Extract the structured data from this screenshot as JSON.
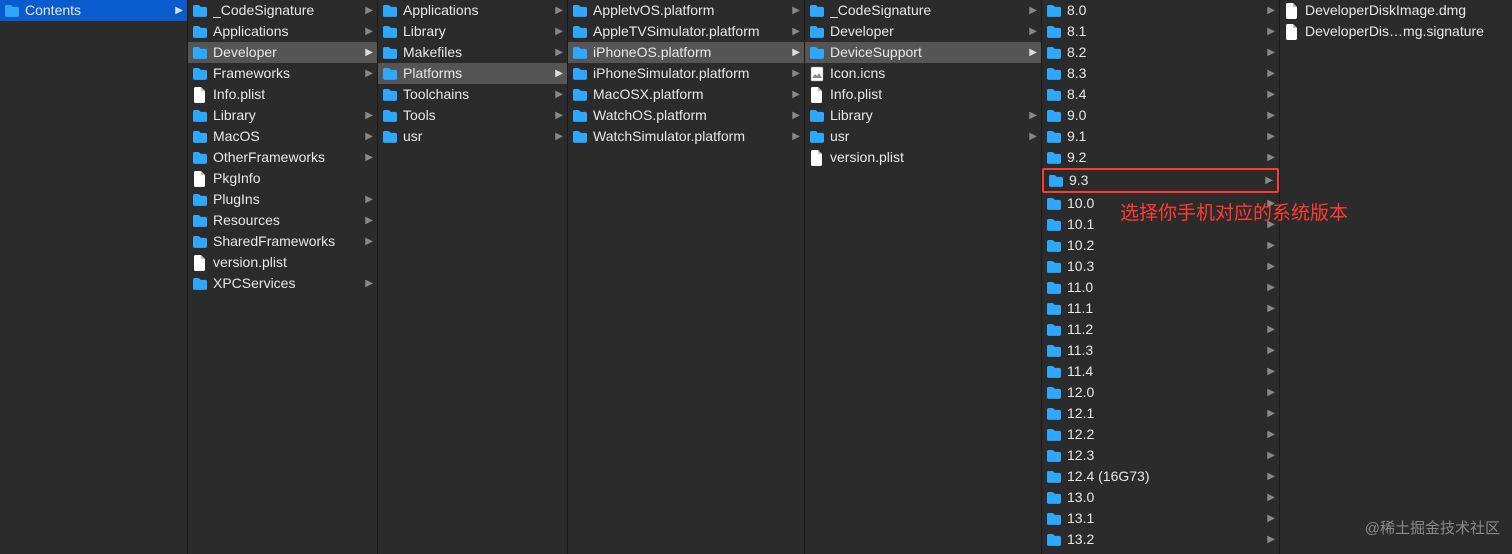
{
  "columns": [
    {
      "width_class": "col0",
      "items": [
        {
          "name": "Contents",
          "type": "folder",
          "hasChildren": true,
          "state": "selected"
        }
      ]
    },
    {
      "width_class": "col1",
      "items": [
        {
          "name": "_CodeSignature",
          "type": "folder",
          "hasChildren": true
        },
        {
          "name": "Applications",
          "type": "folder",
          "hasChildren": true
        },
        {
          "name": "Developer",
          "type": "folder",
          "hasChildren": true,
          "state": "pathed"
        },
        {
          "name": "Frameworks",
          "type": "folder",
          "hasChildren": true
        },
        {
          "name": "Info.plist",
          "type": "file"
        },
        {
          "name": "Library",
          "type": "folder",
          "hasChildren": true
        },
        {
          "name": "MacOS",
          "type": "folder",
          "hasChildren": true
        },
        {
          "name": "OtherFrameworks",
          "type": "folder",
          "hasChildren": true
        },
        {
          "name": "PkgInfo",
          "type": "file"
        },
        {
          "name": "PlugIns",
          "type": "folder",
          "hasChildren": true
        },
        {
          "name": "Resources",
          "type": "folder",
          "hasChildren": true
        },
        {
          "name": "SharedFrameworks",
          "type": "folder",
          "hasChildren": true
        },
        {
          "name": "version.plist",
          "type": "file"
        },
        {
          "name": "XPCServices",
          "type": "folder",
          "hasChildren": true
        }
      ]
    },
    {
      "width_class": "col2",
      "items": [
        {
          "name": "Applications",
          "type": "folder",
          "hasChildren": true
        },
        {
          "name": "Library",
          "type": "folder",
          "hasChildren": true
        },
        {
          "name": "Makefiles",
          "type": "folder",
          "hasChildren": true
        },
        {
          "name": "Platforms",
          "type": "folder",
          "hasChildren": true,
          "state": "pathed"
        },
        {
          "name": "Toolchains",
          "type": "folder",
          "hasChildren": true
        },
        {
          "name": "Tools",
          "type": "folder",
          "hasChildren": true
        },
        {
          "name": "usr",
          "type": "folder",
          "hasChildren": true
        }
      ]
    },
    {
      "width_class": "col3",
      "items": [
        {
          "name": "AppletvOS.platform",
          "type": "folder",
          "hasChildren": true
        },
        {
          "name": "AppleTVSimulator.platform",
          "type": "folder",
          "hasChildren": true
        },
        {
          "name": "iPhoneOS.platform",
          "type": "folder",
          "hasChildren": true,
          "state": "pathed"
        },
        {
          "name": "iPhoneSimulator.platform",
          "type": "folder",
          "hasChildren": true
        },
        {
          "name": "MacOSX.platform",
          "type": "folder",
          "hasChildren": true
        },
        {
          "name": "WatchOS.platform",
          "type": "folder",
          "hasChildren": true
        },
        {
          "name": "WatchSimulator.platform",
          "type": "folder",
          "hasChildren": true
        }
      ]
    },
    {
      "width_class": "col4",
      "items": [
        {
          "name": "_CodeSignature",
          "type": "folder",
          "hasChildren": true
        },
        {
          "name": "Developer",
          "type": "folder",
          "hasChildren": true
        },
        {
          "name": "DeviceSupport",
          "type": "folder",
          "hasChildren": true,
          "state": "pathed"
        },
        {
          "name": "Icon.icns",
          "type": "image"
        },
        {
          "name": "Info.plist",
          "type": "file"
        },
        {
          "name": "Library",
          "type": "folder",
          "hasChildren": true
        },
        {
          "name": "usr",
          "type": "folder",
          "hasChildren": true
        },
        {
          "name": "version.plist",
          "type": "file"
        }
      ]
    },
    {
      "width_class": "col5",
      "items": [
        {
          "name": "8.0",
          "type": "folder",
          "hasChildren": true
        },
        {
          "name": "8.1",
          "type": "folder",
          "hasChildren": true
        },
        {
          "name": "8.2",
          "type": "folder",
          "hasChildren": true
        },
        {
          "name": "8.3",
          "type": "folder",
          "hasChildren": true
        },
        {
          "name": "8.4",
          "type": "folder",
          "hasChildren": true
        },
        {
          "name": "9.0",
          "type": "folder",
          "hasChildren": true
        },
        {
          "name": "9.1",
          "type": "folder",
          "hasChildren": true
        },
        {
          "name": "9.2",
          "type": "folder",
          "hasChildren": true
        },
        {
          "name": "9.3",
          "type": "folder",
          "hasChildren": true,
          "state": "highlight"
        },
        {
          "name": "10.0",
          "type": "folder",
          "hasChildren": true
        },
        {
          "name": "10.1",
          "type": "folder",
          "hasChildren": true
        },
        {
          "name": "10.2",
          "type": "folder",
          "hasChildren": true
        },
        {
          "name": "10.3",
          "type": "folder",
          "hasChildren": true
        },
        {
          "name": "11.0",
          "type": "folder",
          "hasChildren": true
        },
        {
          "name": "11.1",
          "type": "folder",
          "hasChildren": true
        },
        {
          "name": "11.2",
          "type": "folder",
          "hasChildren": true
        },
        {
          "name": "11.3",
          "type": "folder",
          "hasChildren": true
        },
        {
          "name": "11.4",
          "type": "folder",
          "hasChildren": true
        },
        {
          "name": "12.0",
          "type": "folder",
          "hasChildren": true
        },
        {
          "name": "12.1",
          "type": "folder",
          "hasChildren": true
        },
        {
          "name": "12.2",
          "type": "folder",
          "hasChildren": true
        },
        {
          "name": "12.3",
          "type": "folder",
          "hasChildren": true
        },
        {
          "name": "12.4 (16G73)",
          "type": "folder",
          "hasChildren": true
        },
        {
          "name": "13.0",
          "type": "folder",
          "hasChildren": true
        },
        {
          "name": "13.1",
          "type": "folder",
          "hasChildren": true
        },
        {
          "name": "13.2",
          "type": "folder",
          "hasChildren": true
        }
      ]
    },
    {
      "width_class": "col6",
      "items": [
        {
          "name": "DeveloperDiskImage.dmg",
          "type": "file"
        },
        {
          "name": "DeveloperDis…mg.signature",
          "type": "file"
        }
      ]
    }
  ],
  "annotation": "选择你手机对应的系统版本",
  "watermark": "@稀土掘金技术社区",
  "icon_colors": {
    "folder": "#2ea7ff",
    "file_bg": "#ffffff"
  }
}
